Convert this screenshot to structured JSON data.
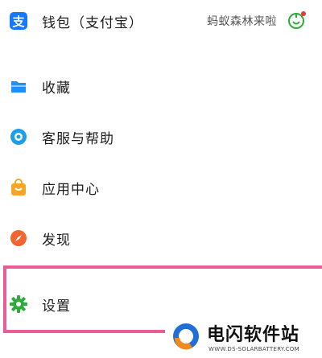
{
  "menu": {
    "wallet": {
      "label": "钱包（支付宝）",
      "promo": "蚂蚁森林来啦"
    },
    "favorites": {
      "label": "收藏"
    },
    "support": {
      "label": "客服与帮助"
    },
    "apps": {
      "label": "应用中心"
    },
    "discover": {
      "label": "发现"
    },
    "settings": {
      "label": "设置"
    }
  },
  "icons": {
    "wallet": "alipay-icon",
    "promo": "ant-forest-icon",
    "favorites": "folder-icon",
    "support": "headset-icon",
    "apps": "shopping-bag-icon",
    "discover": "compass-icon",
    "settings": "gear-icon"
  },
  "colors": {
    "alipay": "#1677ff",
    "favorites": "#1e90ff",
    "support": "#1a9fe8",
    "apps": "#f5a623",
    "discover": "#f26430",
    "settings": "#2faa3c",
    "highlight": "#e85c98",
    "notification_dot": "#e53935"
  },
  "watermark": {
    "title": "电闪软件站",
    "url": "WWW.DS-SOLARBATTERY.COM"
  }
}
